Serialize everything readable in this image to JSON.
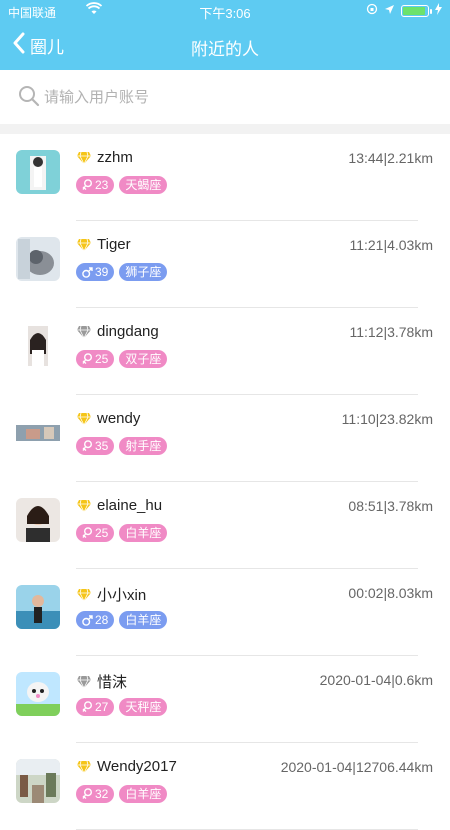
{
  "status": {
    "carrier": "中国联通",
    "time": "下午3:06"
  },
  "nav": {
    "back_label": "圈儿",
    "title": "附近的人"
  },
  "search": {
    "placeholder": "请输入用户账号"
  },
  "colors": {
    "header": "#5ecbf2",
    "female": "#f08ac5",
    "male": "#7b9cf0",
    "gem_gold": "#f5c518",
    "gem_gray": "#9a9a9a"
  },
  "users": [
    {
      "name": "zzhm",
      "meta": "13:44|2.21km",
      "gender": "female",
      "age": "23",
      "zodiac": "天蝎座",
      "gem": "gold"
    },
    {
      "name": "Tiger",
      "meta": "11:21|4.03km",
      "gender": "male",
      "age": "39",
      "zodiac": "狮子座",
      "gem": "gold"
    },
    {
      "name": "dingdang",
      "meta": "11:12|3.78km",
      "gender": "female",
      "age": "25",
      "zodiac": "双子座",
      "gem": "gray"
    },
    {
      "name": "wendy",
      "meta": "11:10|23.82km",
      "gender": "female",
      "age": "35",
      "zodiac": "射手座",
      "gem": "gold"
    },
    {
      "name": "elaine_hu",
      "meta": "08:51|3.78km",
      "gender": "female",
      "age": "25",
      "zodiac": "白羊座",
      "gem": "gold"
    },
    {
      "name": "小小xin",
      "meta": "00:02|8.03km",
      "gender": "male",
      "age": "28",
      "zodiac": "白羊座",
      "gem": "gold"
    },
    {
      "name": "惜沫",
      "meta": "2020-01-04|0.6km",
      "gender": "female",
      "age": "27",
      "zodiac": "天秤座",
      "gem": "gray"
    },
    {
      "name": "Wendy2017",
      "meta": "2020-01-04|12706.44km",
      "gender": "female",
      "age": "32",
      "zodiac": "白羊座",
      "gem": "gold"
    }
  ]
}
